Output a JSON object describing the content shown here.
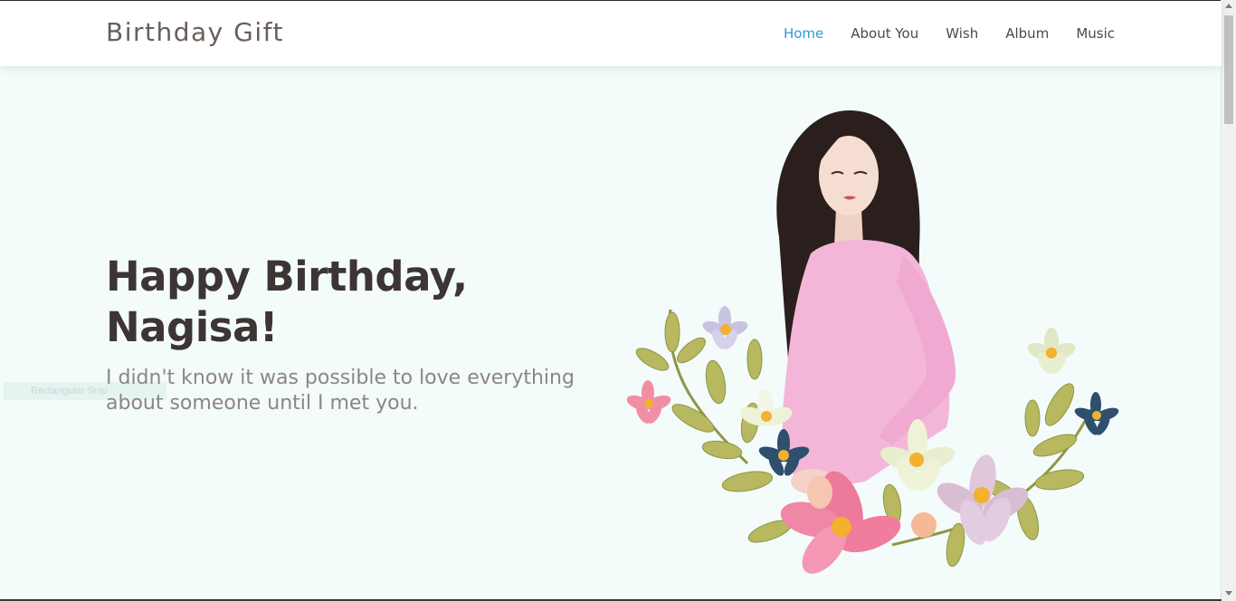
{
  "navbar": {
    "brand": "Birthday Gift",
    "links": [
      "Home",
      "About You",
      "Wish",
      "Album",
      "Music"
    ],
    "active": "Home"
  },
  "hero": {
    "title_line1": "Happy Birthday,",
    "title_line2": "Nagisa!",
    "subtitle": "I didn't know it was possible to love everything about someone until I met you."
  },
  "ghost_label": "Rectangular Snip",
  "colors": {
    "accent": "#2d9ad6",
    "background": "#f3fbfb",
    "title": "#3d3533",
    "subtitle": "#8d8681",
    "dress": "#f3b6d8"
  },
  "icons": {
    "hero_image": "girl-with-flowers-illustration"
  }
}
